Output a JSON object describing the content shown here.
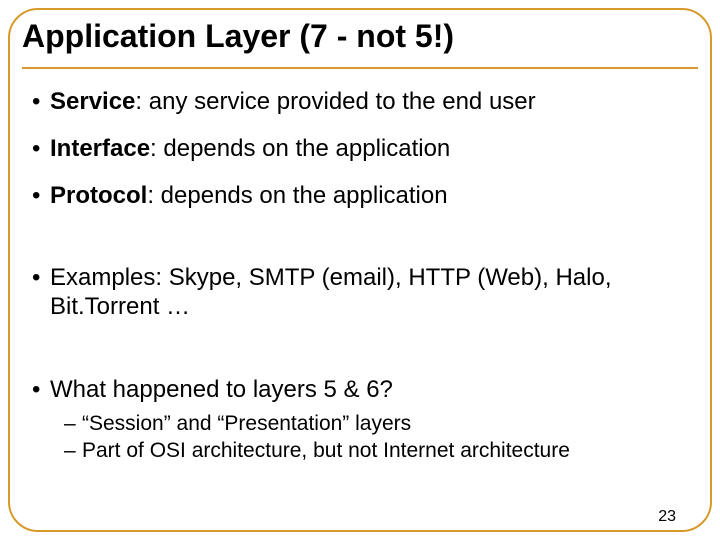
{
  "title": "Application Layer (7 - not 5!)",
  "bullets": {
    "b1": {
      "label": "Service",
      "text": ": any service provided to the end user"
    },
    "b2": {
      "label": "Interface",
      "text": ": depends on the application"
    },
    "b3": {
      "label": "Protocol",
      "text": ": depends on the application"
    },
    "b4": {
      "text": "Examples: Skype, SMTP (email), HTTP (Web), Halo, Bit.Torrent  …"
    },
    "b5": {
      "text": "What happened to layers 5 & 6?"
    }
  },
  "subs": {
    "s1": "“Session” and “Presentation” layers",
    "s2": "Part of OSI architecture, but not Internet architecture"
  },
  "pagenum": "23"
}
